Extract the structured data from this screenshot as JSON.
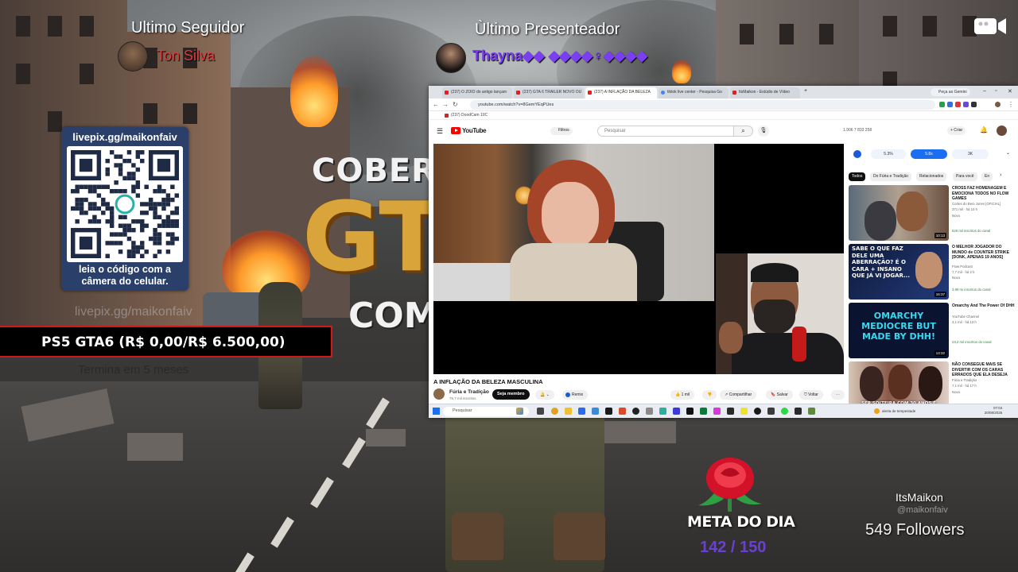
{
  "overlay": {
    "ultimo_seguidor_label": "Ultimo Seguidor",
    "ultimo_seguidor_name": "Ton Silva",
    "ultimo_presenteador_label": "Ùltimo Presenteador",
    "ultimo_presenteador_name": "Thayna◆◆ ◆◆◆◆♀◆◆◆◆",
    "qr_url": "livepix.gg/maikonfaiv",
    "qr_caption_1": "leia o código com a",
    "qr_caption_2": "câmera do celular.",
    "ghost_url": "livepix.gg/maikonfaiv",
    "goal_text": "PS5 GTA6 (R$ 0,00/R$ 6.500,00)",
    "goal_sub": "Termina em 5 meses",
    "meta_title": "META DO DIA",
    "meta_count": "142 / 150",
    "channel_name": "ItsMaikon",
    "channel_handle": "@maikonfaiv",
    "followers": "549 Followers",
    "icon_camera": "video-camera-icon",
    "icon_rose": "rose-icon"
  },
  "poster": {
    "line1": "COBERT",
    "line2": "GT",
    "line3": "COM"
  },
  "browser": {
    "tabs": [
      "(237) O ZOIO do antigo lançam",
      "(237) GTA 6 TRAILER NOVO OU",
      "(237) A INFLAÇÃO DA BELEZA",
      "tiktok live center - Pesquisa Go",
      "ItsMaikon - Estúdio de Vídeo"
    ],
    "gemini": "Peça ao Gemini",
    "url": "youtube.com/watch?v=8GemYEqPUes",
    "bookmark": "(237) DoodCam 10C"
  },
  "youtube": {
    "logo": "YouTube",
    "filters": "Filtros",
    "search_placeholder": "Pesquisar",
    "stats": "1.906   7   833   258",
    "create": "+ Criar",
    "notif_count": "9+",
    "video_title": "A INFLAÇÃO DA BELEZA MASCULINA",
    "channel": "Fúria e Tradição",
    "subs": "76,7 mil inscritos",
    "member_btn": "Seja membro",
    "remix": "Remix",
    "likes": "1 mil",
    "share": "Compartilhar",
    "save": "Salvar",
    "voice": "Voltar",
    "pills": [
      "5.3%",
      "5.8x",
      "3K"
    ],
    "chips": [
      "Todos",
      "Do Fúria e Tradição",
      "Relacionados",
      "Para você",
      "En"
    ],
    "cards": [
      {
        "title": "CROSS FAZ HOMENAGEM E EMOCIONA TODOS NO FLOW GAMES",
        "channel": "Cortes do Beni Jones [OFICIAL]",
        "meta": "371 mil · há 10 h",
        "badge": "Novo",
        "extra": "626 mil inscritos do canal",
        "dur": "10:13",
        "thumb_text": ""
      },
      {
        "title": "O MELHOR JOGADOR DO MUNDO de COUNTER STRIKE [DONK, APENAS 19 ANOS]",
        "channel": "Flow Podcast",
        "meta": "7,7 mil · há 2 h",
        "badge": "Novo",
        "extra": "3,99 mi inscritos do canal",
        "dur": "16:37",
        "thumb_text": "SABE O QUE FAZ DELE UMA ABERRAÇÃO? É O CARA + INSANO QUE JÁ VI JOGAR..."
      },
      {
        "title": "Omarchy And The Power Of DHH",
        "channel": "YouTube Channel",
        "meta": "3,1 mil · há 13 h",
        "badge": "",
        "extra": "23,2 mil inscritos do canal",
        "dur": "13:32",
        "thumb_text": "OMARCHY MEDIOCRE BUT MADE BY DHH!"
      },
      {
        "title": "NÃO CONSEGUE MAIS SE DIVERTIR COM OS CARAS ERRADOS QUE ELA DESEJA",
        "channel": "Fúria e Tradição",
        "meta": "7,1 mil · há 17 h",
        "badge": "Novo",
        "extra": "",
        "dur": "",
        "thumb_text": "SER SOLTEIRA COM 30 ANOS É HORRÍVEL"
      }
    ]
  },
  "taskbar": {
    "search": "Pesquisar",
    "weather": "alerta de tempestade",
    "time": "07:04",
    "date": "20/08/2025"
  }
}
